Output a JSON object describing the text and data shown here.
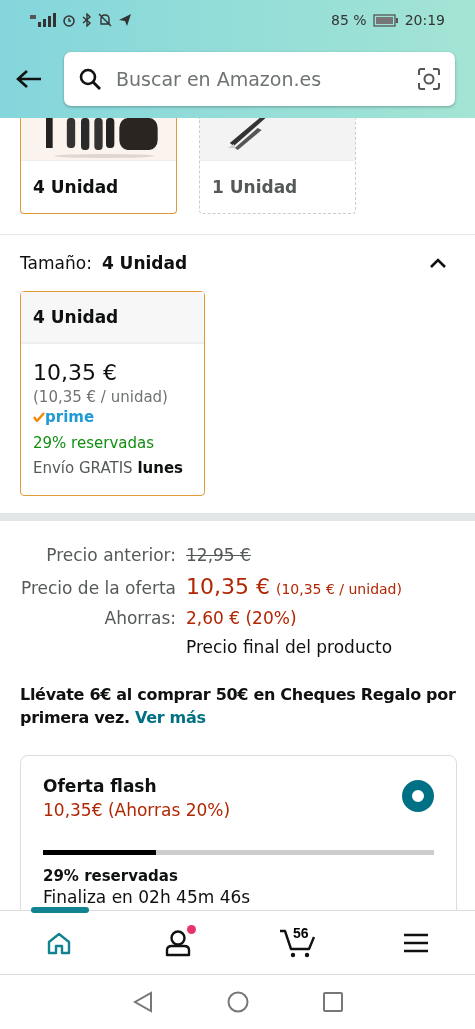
{
  "status_bar": {
    "battery": "85 %",
    "time": "20:19"
  },
  "search": {
    "placeholder": "Buscar en Amazon.es"
  },
  "swatches": [
    {
      "label": "4 Unidad",
      "selected": true
    },
    {
      "label": "1 Unidad",
      "selected": false
    }
  ],
  "size_selector": {
    "label": "Tamaño:",
    "value": "4 Unidad",
    "expanded": true
  },
  "options": [
    {
      "title": "4 Unidad",
      "price": "10,35 €",
      "unit_price": "(10,35 € / unidad)",
      "prime": "prime",
      "reserved": "29% reservadas",
      "shipping": "Envío GRATIS **lunes**",
      "selected": true
    }
  ],
  "price_rows": [
    {
      "kind": "strike",
      "label": "Precio anterior:",
      "value": "12,95 €"
    },
    {
      "kind": "deal",
      "label": "Precio de la oferta",
      "value": "10,35 €",
      "note": "(10,35 € / unidad)"
    },
    {
      "kind": "savings",
      "label": "Ahorras:",
      "value": "2,60 € (20%)"
    },
    {
      "kind": "plain",
      "value": "Precio final del producto"
    }
  ],
  "promo": {
    "text": "Llévate 6€ al comprar 50€ en Cheques Regalo por primera vez.",
    "link": "Ver más"
  },
  "deal": {
    "title": "Oferta flash",
    "price": "10,35€ (Ahorras 20%)",
    "selected": true,
    "level": 0.29,
    "reserved": "29% reservadas",
    "countdown": "Finaliza en 02h 45m 46s"
  },
  "bottom_nav": [
    {
      "kind": "home",
      "selected": true
    },
    {
      "kind": "account",
      "selected": false,
      "notification": true
    },
    {
      "kind": "cart",
      "selected": false,
      "count": "56"
    },
    {
      "kind": "menu",
      "selected": false
    }
  ]
}
